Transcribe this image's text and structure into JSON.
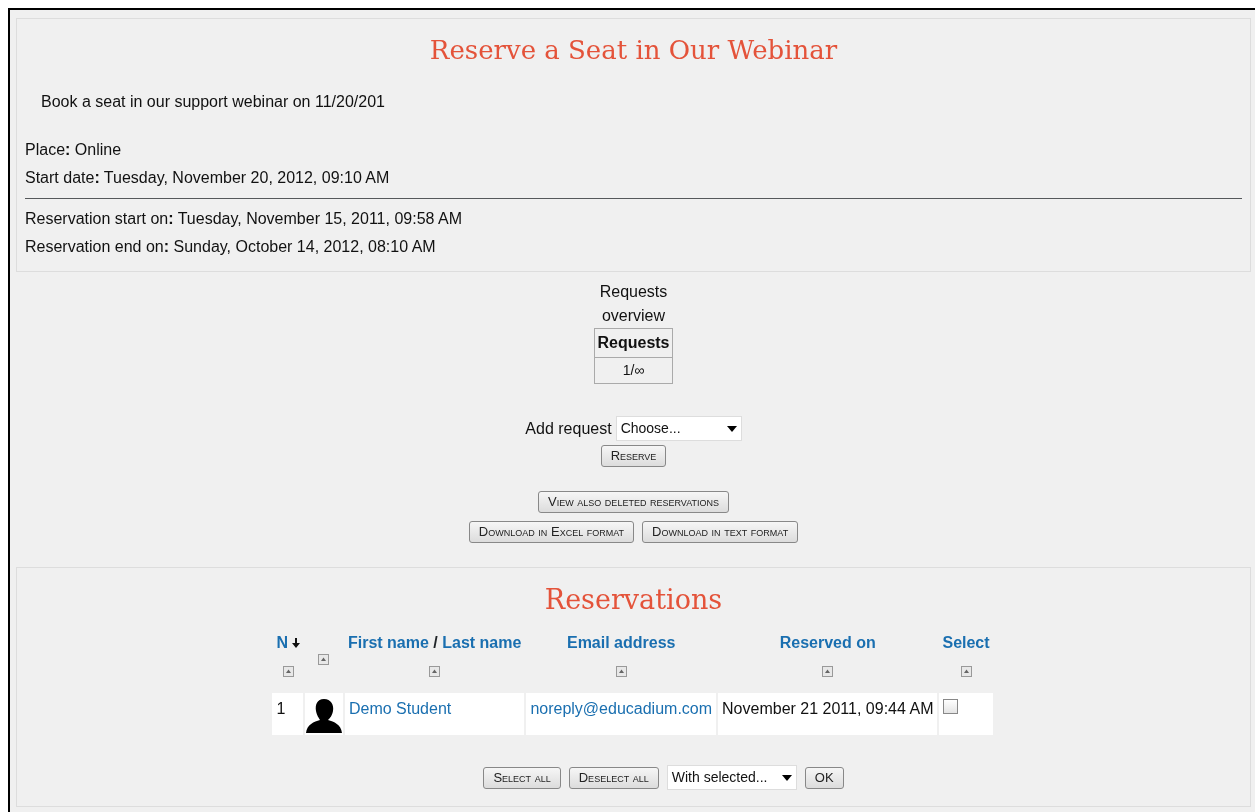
{
  "event": {
    "title": "Reserve a Seat in Our Webinar",
    "description": "Book a seat in our support webinar on 11/20/201",
    "details": [
      "Place**:** Online",
      "Start date**:** Tuesday, November 20, 2012, 09:10 AM"
    ],
    "reservation_dates": [
      "Reservation start on**:** Tuesday, November 15, 2011, 09:58 AM",
      "Reservation end on**:** Sunday, October 14, 2012, 08:10 AM"
    ]
  },
  "requests_overview": {
    "caption_lines": [
      "Requests",
      "overview"
    ],
    "header": "Requests",
    "value": "1/∞"
  },
  "add_request": {
    "label": "Add request",
    "select_value": "Choose...",
    "button": "Reserve"
  },
  "actions": [
    [
      "View also deleted reservations"
    ],
    [
      "Download in Excel format",
      "Download in text format"
    ]
  ],
  "reservations": {
    "title": "Reservations",
    "columns": [
      {
        "kind": "links",
        "labels": [
          "N"
        ],
        "sorted": true
      },
      {
        "kind": "blank"
      },
      {
        "kind": "links",
        "labels": [
          "First name",
          "Last name"
        ],
        "separator": "/",
        "sorted": false
      },
      {
        "kind": "links",
        "labels": [
          "Email address"
        ],
        "sorted": false
      },
      {
        "kind": "links",
        "labels": [
          "Reserved on"
        ],
        "sorted": false
      },
      {
        "kind": "links",
        "labels": [
          "Select"
        ],
        "sorted": false
      }
    ],
    "rows": [
      {
        "n": "1",
        "name": "Demo Student",
        "email": "noreply@educadium.com",
        "reserved_on": "November 21 2011, 09:44 AM",
        "checked": false
      }
    ]
  },
  "bulk": {
    "buttons": [
      "Select all",
      "Deselect all"
    ],
    "select_value": "With selected...",
    "ok": "OK"
  }
}
